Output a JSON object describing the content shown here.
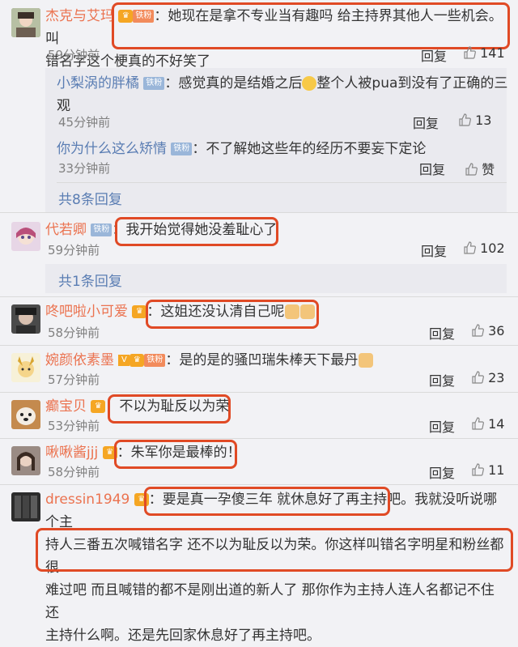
{
  "comments": [
    {
      "name": "杰克与艾玛",
      "badge": "铁粉",
      "text1": "：她现在是拿不专业当有趣吗 给主持界其他人一些机会。叫",
      "text2": "错名字这个梗真的不好笑了",
      "time": "59分钟前",
      "reply": "回复",
      "likes": "141"
    },
    {
      "name": "代若卿",
      "badge": "铁粉",
      "text1": "：我开始觉得她没羞耻心了",
      "time": "59分钟前",
      "reply": "回复",
      "likes": "102"
    },
    {
      "name": "咚吧啦小可爱",
      "text1": "：这姐还没认清自己呢",
      "time": "58分钟前",
      "reply": "回复",
      "likes": "36"
    },
    {
      "name": "婉颜依素墨",
      "badge": "铁粉",
      "text1": "：是的是的骚凹瑞朱棒天下最丹",
      "time": "57分钟前",
      "reply": "回复",
      "likes": "23"
    },
    {
      "name": "癫宝贝",
      "text1": "：不以为耻反以为荣",
      "time": "53分钟前",
      "reply": "回复",
      "likes": "14"
    },
    {
      "name": "啾啾酱jjj",
      "text1": "：朱军你是最棒的！",
      "time": "58分钟前",
      "reply": "回复",
      "likes": "11"
    },
    {
      "name": "dressin1949",
      "text1": "：要是真一孕傻三年 就休息好了再主持吧。我就没听说哪个主",
      "text2": "持人三番五次喊错名字 还不以为耻反以为荣。你这样叫错名字明星和粉丝都很",
      "text3": "难过吧 而且喊错的都不是刚出道的新人了 那你作为主持人连人名都记不住 还",
      "text4": "主持什么啊。还是先回家休息好了再主持吧。"
    }
  ],
  "replies": [
    {
      "name": "小梨涡的胖橘",
      "badge": "铁粉",
      "text1": "：感觉真的是结婚之后",
      "text1b": "整个人被pua到没有了正确的三",
      "text2": "观",
      "time": "45分钟前",
      "reply": "回复",
      "likes": "13"
    },
    {
      "name": "你为什么这么矫情",
      "badge": "铁粉",
      "text1": "：不了解她这些年的经历不要妄下定论",
      "time": "33分钟前",
      "reply": "回复",
      "likes": "赞"
    }
  ],
  "more": [
    "共8条回复",
    "共1条回复"
  ],
  "fan_badge": "铁粉",
  "colors": {
    "name": "#eb7350",
    "highlight": "#e04a25",
    "link": "#5a7db3"
  }
}
